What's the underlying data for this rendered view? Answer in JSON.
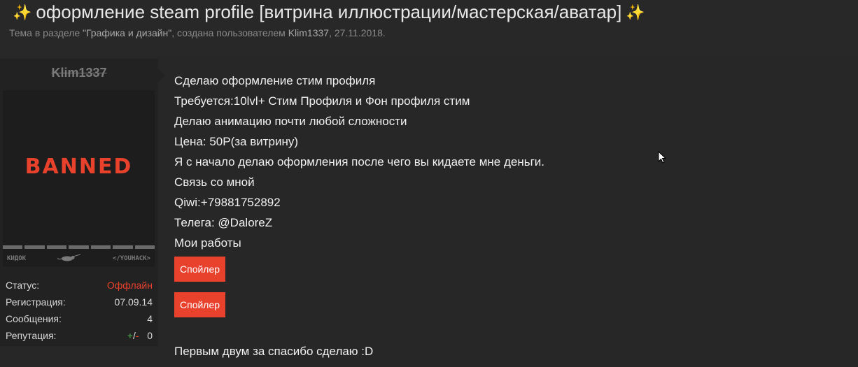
{
  "thread": {
    "title": "оформление steam profile [витрина иллюстрации/мастерская/аватар]",
    "title_icon": "sparkles-icon",
    "subtitle_prefix": "Тема в разделе ",
    "section": "\"Графика и дизайн\"",
    "subtitle_mid": ", создана пользователем ",
    "author": "Klim1337",
    "subtitle_date": ", 27.11.2018."
  },
  "user": {
    "name": "Klim1337",
    "avatar_text": "BANNED",
    "avatar_logos": [
      "КИДОК",
      "</YOUHACK>"
    ],
    "stats": [
      {
        "label": "Статус:",
        "value": "Оффлайн"
      },
      {
        "label": "Регистрация:",
        "value": "07.09.14"
      },
      {
        "label": "Сообщения:",
        "value": "4"
      },
      {
        "label": "Репутация:",
        "plus": "+",
        "slash": "/",
        "minus": "-",
        "value": "0"
      }
    ]
  },
  "post": {
    "lines": [
      "Сделаю оформление стим профиля",
      "Требуется:10lvl+ Стим Профиля и Фон профиля стим",
      "Делаю анимацию почти любой сложности",
      "Цена: 50Р(за витрину)",
      "Я с начало делаю оформления после чего вы кидаете мне деньги.",
      "Связь со мной",
      "Qiwi:+79881752892",
      "Телега: @DaloreZ",
      "Мои работы"
    ],
    "spoiler_label_1": "Спойлер",
    "spoiler_label_2": "Спойлер",
    "footer": "Первым двум за спасибо сделаю :D"
  },
  "colors": {
    "accent": "#e8412c",
    "background": "#282828",
    "panel": "#222222"
  }
}
